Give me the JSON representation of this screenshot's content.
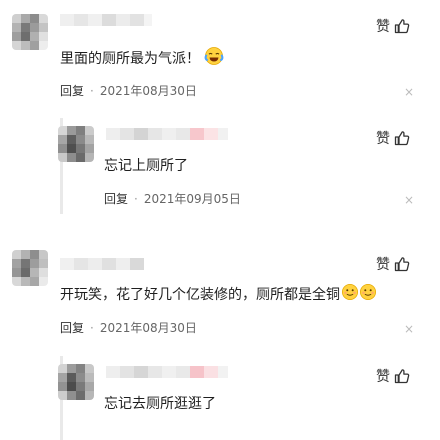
{
  "like_label": "赞",
  "comments": [
    {
      "text": "里面的厕所最为气派！",
      "emoji": "laugh-cry-emoji",
      "reply_label": "回复",
      "date": "2021年08月30日",
      "close": "×",
      "reply": {
        "text": "忘记上厕所了",
        "reply_label": "回复",
        "date": "2021年09月05日",
        "close": "×"
      }
    },
    {
      "text": "开玩笑，花了好几个亿装修的，厕所都是全铜",
      "emoji": "awkward-smile-emoji",
      "reply_label": "回复",
      "date": "2021年08月30日",
      "close": "×",
      "reply": {
        "text": "忘记去厕所逛逛了"
      }
    }
  ]
}
